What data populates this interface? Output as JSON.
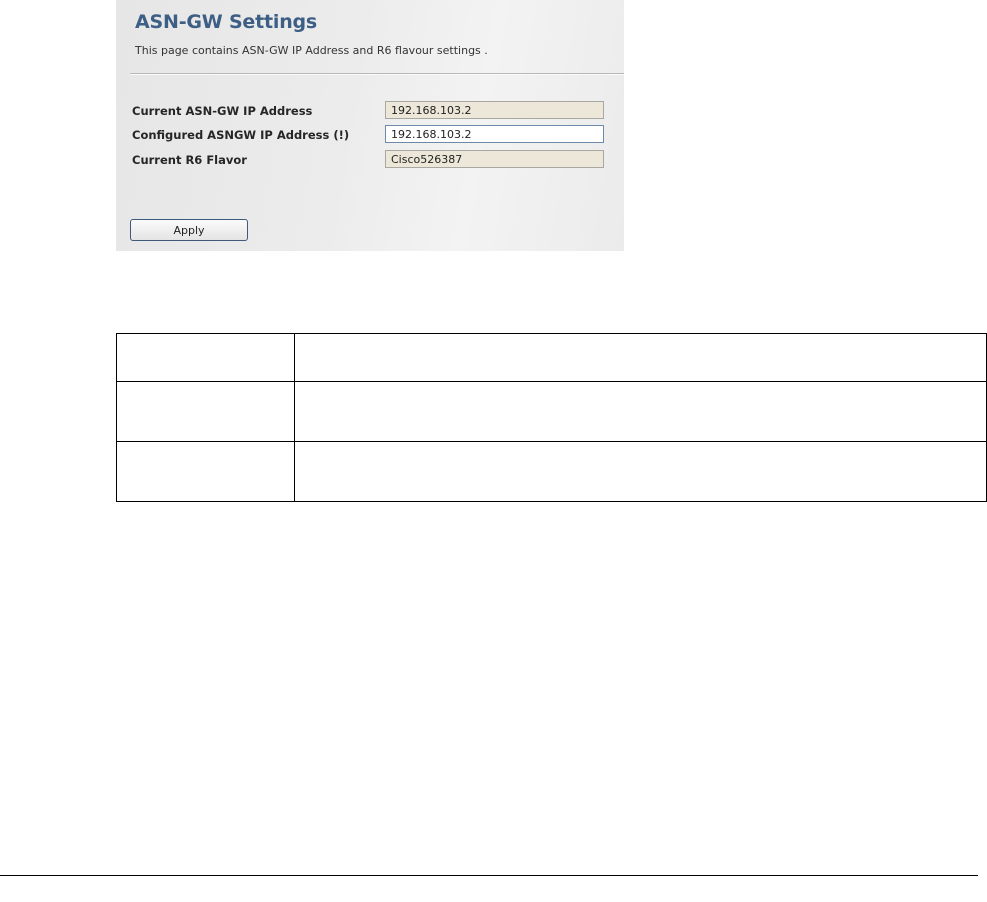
{
  "settings_page": {
    "title": "ASN-GW Settings",
    "subtitle": "This page contains ASN-GW IP Address and R6 flavour settings .",
    "fields": [
      {
        "label": "Current ASN-GW IP Address",
        "value": "192.168.103.2",
        "readonly": true
      },
      {
        "label": "Configured ASNGW IP Address (!)",
        "value": "192.168.103.2",
        "readonly": false
      },
      {
        "label": "Current R6 Flavor",
        "value": "Cisco526387",
        "readonly": true
      }
    ],
    "apply_label": "Apply"
  },
  "colors": {
    "title": "#3d5e85",
    "readonly_field_bg": "#ece7d8",
    "panel_bg": "#e9e9e9",
    "button_border": "#3d5a7a"
  }
}
